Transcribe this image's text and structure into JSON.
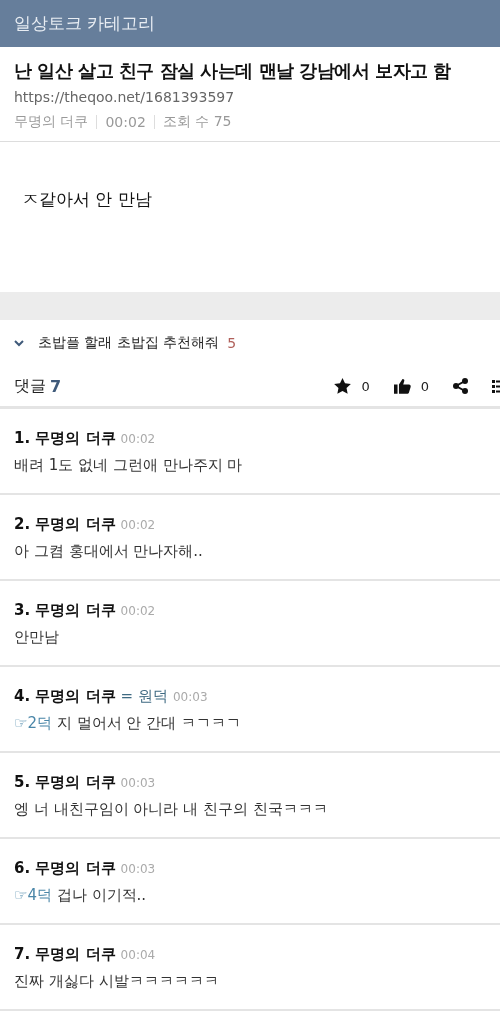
{
  "header": {
    "title": "일상토크 카테고리"
  },
  "post": {
    "title": "난 일산 살고 친구 잠실 사는데 맨날 강남에서 보자고 함",
    "url": "https://theqoo.net/1681393597",
    "author": "무명의 더쿠",
    "time": "00:02",
    "views": "조회 수 75",
    "body": "ㅈ같아서 안 만남"
  },
  "related": {
    "expanded": true,
    "title": "초밥플 할래 초밥집 추천해줘",
    "count": "5"
  },
  "comments_bar": {
    "label": "댓글",
    "count": "7",
    "stars": "0",
    "likes": "0"
  },
  "comments": [
    {
      "number": "1.",
      "author": "무명의 더쿠",
      "time": "00:02",
      "text": "배려 1도 없네 그런애 만나주지 마"
    },
    {
      "number": "2.",
      "author": "무명의 더쿠",
      "time": "00:02",
      "text": "아 그켬 홍대에서 만나자해.."
    },
    {
      "number": "3.",
      "author": "무명의 더쿠",
      "time": "00:02",
      "text": "안만남"
    },
    {
      "number": "4.",
      "author": "무명의 더쿠",
      "tag": "= 원덕",
      "time": "00:03",
      "reply_to": "☞2덕",
      "text": "지 멀어서 안 간대 ㅋㄱㅋㄱ"
    },
    {
      "number": "5.",
      "author": "무명의 더쿠",
      "time": "00:03",
      "text": "엥 너 내친구임이 아니라 내 친구의 친국ㅋㅋㅋ"
    },
    {
      "number": "6.",
      "author": "무명의 더쿠",
      "time": "00:03",
      "reply_to": "☞4덕",
      "text": "겁나 이기적.."
    },
    {
      "number": "7.",
      "author": "무명의 더쿠",
      "time": "00:04",
      "text": "진짜 개싫다 시발ㅋㅋㅋㅋㅋㅋ"
    }
  ]
}
